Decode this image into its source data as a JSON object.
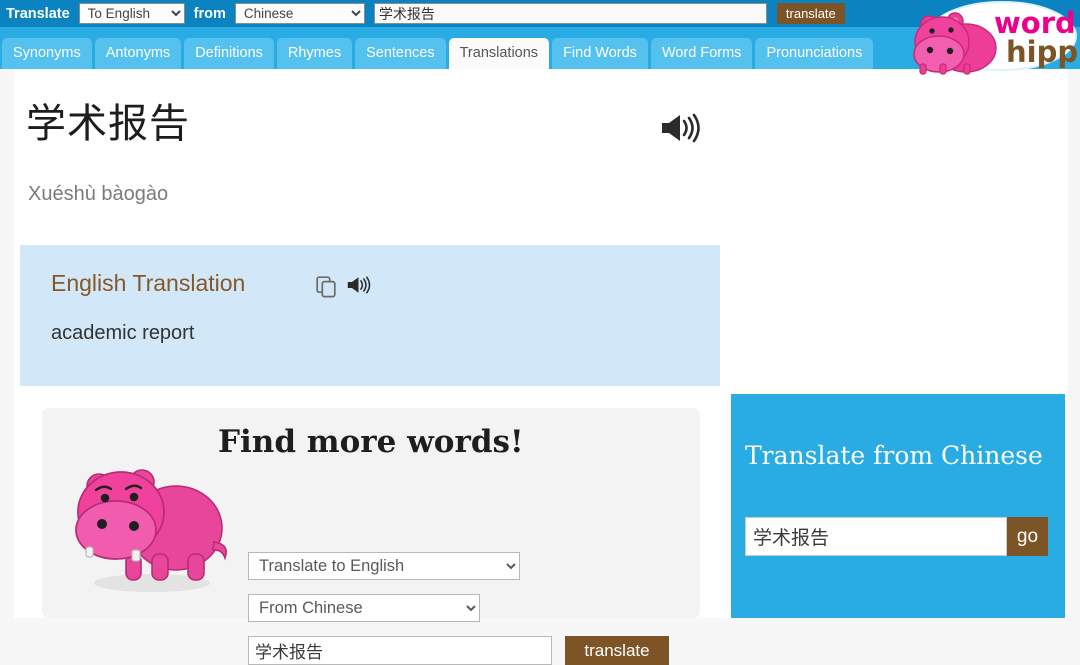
{
  "topbar": {
    "label": "Translate",
    "to_language": "To English",
    "from_word": "from",
    "from_language": "Chinese",
    "query": "学术报告",
    "translate_button": "translate",
    "bg_color": "#0b83c1",
    "button_color": "#7c5426"
  },
  "logo": {
    "word_text": "word",
    "hippo_text": "hippo",
    "word_color": "#ec008c",
    "hippo_color": "#7c5426"
  },
  "tabs": [
    {
      "label": "Synonyms",
      "active": false
    },
    {
      "label": "Antonyms",
      "active": false
    },
    {
      "label": "Definitions",
      "active": false
    },
    {
      "label": "Rhymes",
      "active": false
    },
    {
      "label": "Sentences",
      "active": false
    },
    {
      "label": "Translations",
      "active": true
    },
    {
      "label": "Find Words",
      "active": false
    },
    {
      "label": "Word Forms",
      "active": false
    },
    {
      "label": "Pronunciations",
      "active": false
    }
  ],
  "tabstrip": {
    "bg_color": "#29ace4",
    "tab_color": "#54c1ee",
    "active_tab_color": "#fbfbfb"
  },
  "headword": {
    "text": "学术报告",
    "pinyin": "Xuéshù bàogào",
    "speaker_icon": "speaker-icon"
  },
  "translation_panel": {
    "title": "English Translation",
    "value": "academic report",
    "copy_icon": "copy-icon",
    "speaker_icon": "speaker-icon",
    "bg_color": "#d2e7f7",
    "title_color": "#85582a"
  },
  "find_more_words": {
    "title": "Find more words!",
    "to_language": "Translate to English",
    "from_language": "From Chinese",
    "query": "学术报告",
    "translate_button": "translate",
    "bg_color": "#f3f3f3",
    "hippo_icon": "hippo-mascot-icon"
  },
  "side_widget": {
    "title": "Translate from Chinese",
    "query": "学术报告",
    "go_button": "go",
    "bg_color": "#29ace4",
    "button_color": "#7c5426"
  }
}
